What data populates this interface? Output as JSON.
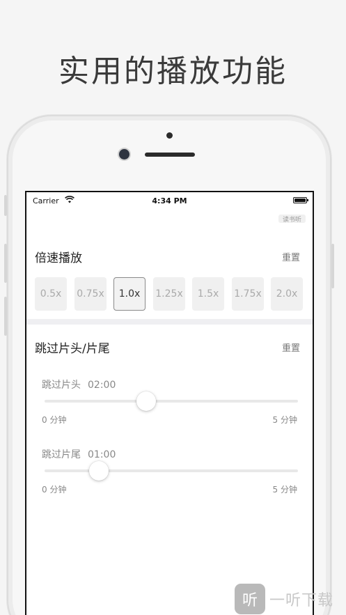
{
  "headline": "实用的播放功能",
  "status_bar": {
    "carrier": "Carrier",
    "time": "4:34 PM"
  },
  "top_chip": "读书听",
  "playback_speed": {
    "title": "倍速播放",
    "reset_label": "重置",
    "options": [
      "0.5x",
      "0.75x",
      "1.0x",
      "1.25x",
      "1.5x",
      "1.75x",
      "2.0x"
    ],
    "selected": "1.0x"
  },
  "skip": {
    "title": "跳过片头/片尾",
    "reset_label": "重置",
    "intro": {
      "label": "跳过片头",
      "value": "02:00",
      "min_label": "0 分钟",
      "max_label": "5 分钟",
      "fraction": 0.4
    },
    "outro": {
      "label": "跳过片尾",
      "value": "01:00",
      "min_label": "0 分钟",
      "max_label": "5 分钟",
      "fraction": 0.2
    }
  },
  "watermark": {
    "logo": "听",
    "text": "一听下载"
  },
  "colors": {
    "selected_border": "#8a8a8a",
    "chip_bg": "#f0f0f0",
    "divider": "#efeff2"
  }
}
